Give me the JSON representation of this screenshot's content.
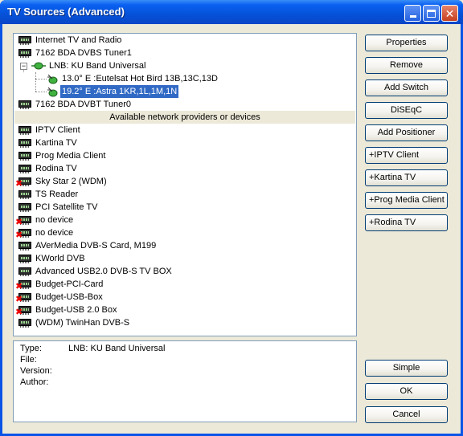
{
  "window": {
    "title": "TV Sources (Advanced)"
  },
  "tree": {
    "items": [
      {
        "label": "Internet TV and Radio"
      },
      {
        "label": "7162 BDA DVBS Tuner1"
      },
      {
        "label": "LNB: KU Band Universal"
      },
      {
        "label": "13.0° E :Eutelsat Hot Bird 13B,13C,13D"
      },
      {
        "label": "19.2° E :Astra 1KR,1L,1M,1N",
        "selected": true
      },
      {
        "label": "7162 BDA DVBT Tuner0"
      }
    ],
    "section_header": "Available network providers or devices",
    "providers": [
      {
        "label": "IPTV Client",
        "error": false
      },
      {
        "label": "Kartina TV",
        "error": false
      },
      {
        "label": "Prog Media Client",
        "error": false
      },
      {
        "label": "Rodina TV",
        "error": false
      },
      {
        "label": "Sky Star 2 (WDM)",
        "error": true
      },
      {
        "label": "TS Reader",
        "error": false
      },
      {
        "label": "PCI Satellite TV",
        "error": false
      },
      {
        "label": "no device",
        "error": true
      },
      {
        "label": "no device",
        "error": true
      },
      {
        "label": "AVerMedia DVB-S Card, M199",
        "error": false
      },
      {
        "label": "KWorld DVB",
        "error": false
      },
      {
        "label": "Advanced USB2.0 DVB-S TV BOX",
        "error": false
      },
      {
        "label": "Budget-PCI-Card",
        "error": true
      },
      {
        "label": "Budget-USB-Box",
        "error": true
      },
      {
        "label": "Budget-USB 2.0 Box",
        "error": true
      },
      {
        "label": "(WDM) TwinHan DVB-S",
        "error": false
      }
    ]
  },
  "info": {
    "type_label": "Type:",
    "type_value": "LNB: KU Band Universal",
    "file_label": "File:",
    "version_label": "Version:",
    "author_label": "Author:"
  },
  "buttons": {
    "properties": "Properties",
    "remove": "Remove",
    "add_switch": "Add Switch",
    "diseqc": "DiSEqC",
    "add_positioner": "Add Positioner",
    "add_iptv": "+IPTV Client",
    "add_kartina": "+Kartina TV",
    "add_progmedia": "+Prog Media Client",
    "add_rodina": "+Rodina TV",
    "simple": "Simple",
    "ok": "OK",
    "cancel": "Cancel"
  }
}
